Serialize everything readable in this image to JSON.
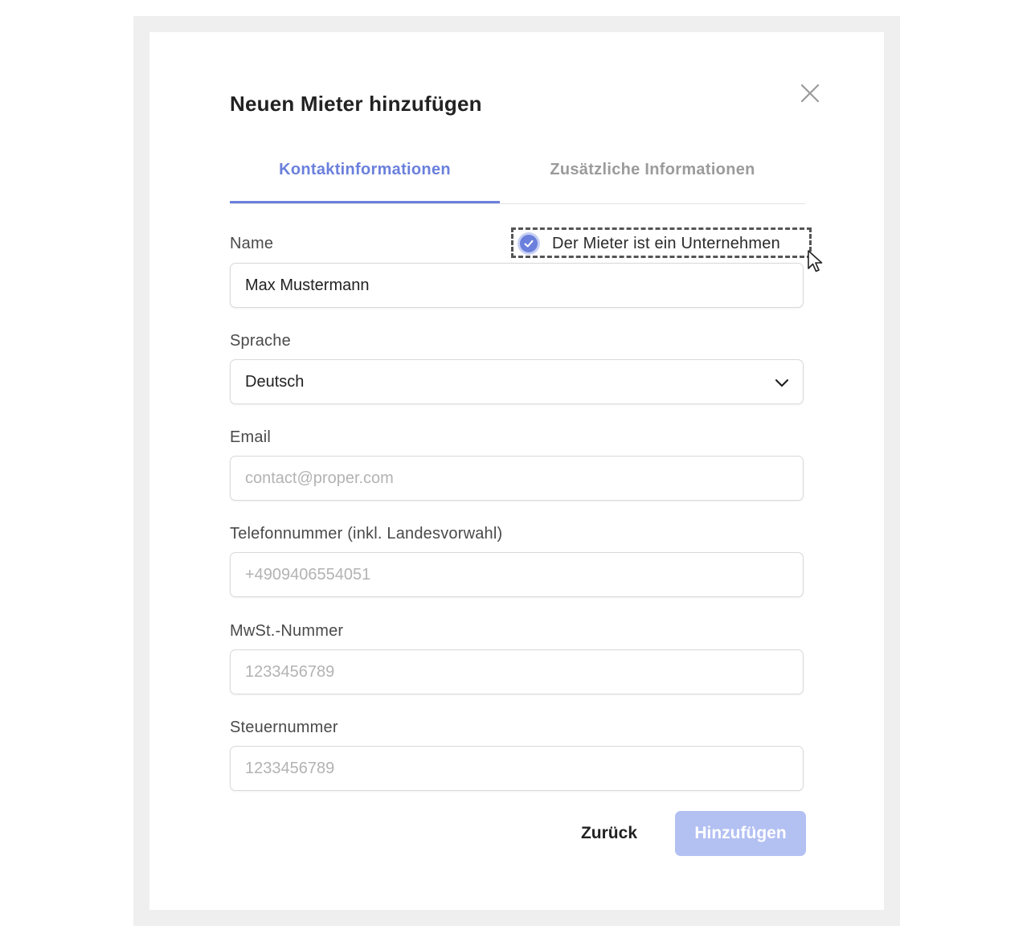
{
  "dialog": {
    "title": "Neuen Mieter hinzufügen",
    "close_icon": "close-icon"
  },
  "tabs": [
    {
      "label": "Kontaktinformationen",
      "active": true
    },
    {
      "label": "Zusätzliche Informationen",
      "active": false
    }
  ],
  "form": {
    "name": {
      "label": "Name",
      "value": "Max Mustermann",
      "placeholder": ""
    },
    "company_checkbox": {
      "label": "Der Mieter ist ein Unternehmen",
      "checked": true
    },
    "language": {
      "label": "Sprache",
      "value": "Deutsch"
    },
    "email": {
      "label": "Email",
      "value": "",
      "placeholder": "contact@proper.com"
    },
    "phone": {
      "label": "Telefonnummer (inkl. Landesvorwahl)",
      "value": "",
      "placeholder": "+4909406554051"
    },
    "vat": {
      "label": "MwSt.-Nummer",
      "value": "",
      "placeholder": "1233456789"
    },
    "tax": {
      "label": "Steuernummer",
      "value": "",
      "placeholder": "1233456789"
    }
  },
  "footer": {
    "back_label": "Zurück",
    "add_label": "Hinzufügen"
  },
  "colors": {
    "accent": "#6b80dc",
    "primary_disabled": "#b3c0f2",
    "frame": "#efefef"
  }
}
